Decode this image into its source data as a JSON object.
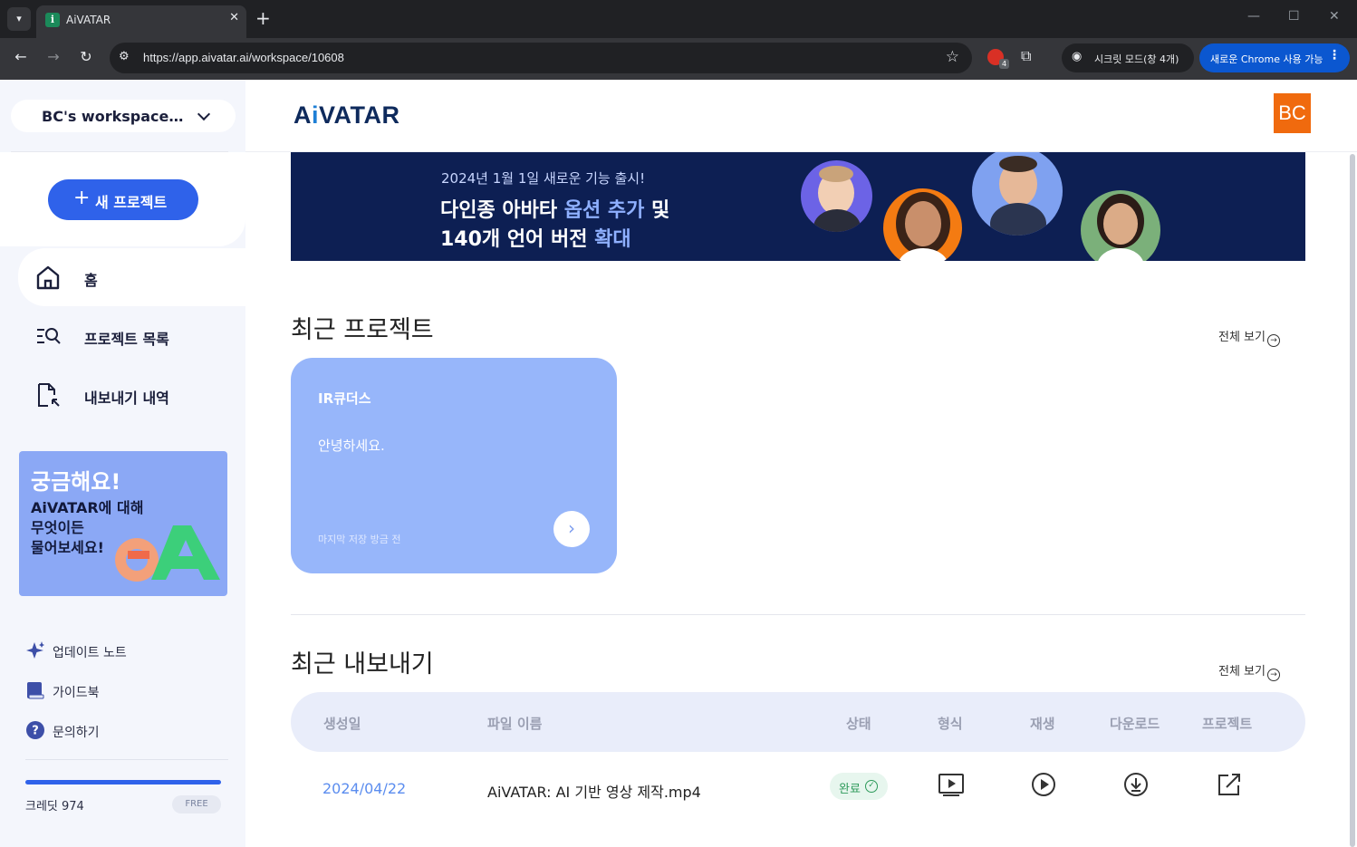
{
  "browser": {
    "tab_title": "AiVATAR",
    "tab_close": "✕",
    "new_tab": "+",
    "url": "https://app.aivatar.ai/workspace/10608",
    "incognito_label": "시크릿 모드(창 4개)",
    "update_label": "새로운 Chrome 사용 가능",
    "ext_badge": "4"
  },
  "sidebar": {
    "workspace_name": "BC's workspace…",
    "new_project_label": "새 프로젝트",
    "nav": [
      {
        "label": "홈",
        "icon": "home-icon"
      },
      {
        "label": "프로젝트 목록",
        "icon": "project-list-icon"
      },
      {
        "label": "내보내기 내역",
        "icon": "export-history-icon"
      }
    ],
    "qa_banner": {
      "title": "궁금해요!",
      "text_line1": "AiVATAR에 대해",
      "text_line2": "무엇이든",
      "text_line3": "물어보세요!"
    },
    "footer_links": [
      {
        "label": "업데이트 노트",
        "icon": "sparkle-icon"
      },
      {
        "label": "가이드북",
        "icon": "book-icon"
      },
      {
        "label": "문의하기",
        "icon": "question-icon"
      }
    ],
    "credit_label": "크레딧 974",
    "plan_badge": "FREE"
  },
  "header": {
    "logo_prefix": "A",
    "logo_i": "i",
    "logo_suffix": "VATAR",
    "avatar_initials": "BC"
  },
  "promo": {
    "subtitle": "2024년 1월 1일 새로운 기능 출시!",
    "line1_a": "다인종 아바타 ",
    "line1_b": "옵션 추가",
    "line1_c": " 및",
    "line2_a": "140개 언어 버전 ",
    "line2_b": "확대"
  },
  "recent_projects": {
    "title": "최근 프로젝트",
    "see_all": "전체 보기",
    "cards": [
      {
        "name": "IR큐더스",
        "description": "안녕하세요.",
        "saved": "마지막 저장 방금 전"
      }
    ]
  },
  "recent_exports": {
    "title": "최근 내보내기",
    "see_all": "전체 보기",
    "columns": [
      "생성일",
      "파일 이름",
      "상태",
      "형식",
      "재생",
      "다운로드",
      "프로젝트"
    ],
    "rows": [
      {
        "date": "2024/04/22",
        "file_name": "AiVATAR: AI 기반 영상 제작.mp4",
        "status": "완료"
      }
    ]
  },
  "colors": {
    "accent": "#2f62ea",
    "promo_bg": "#0d1f53",
    "card_bg": "#97b6fa",
    "avatar_bg": "#f06a0e",
    "status_green": "#2d9a5a"
  }
}
